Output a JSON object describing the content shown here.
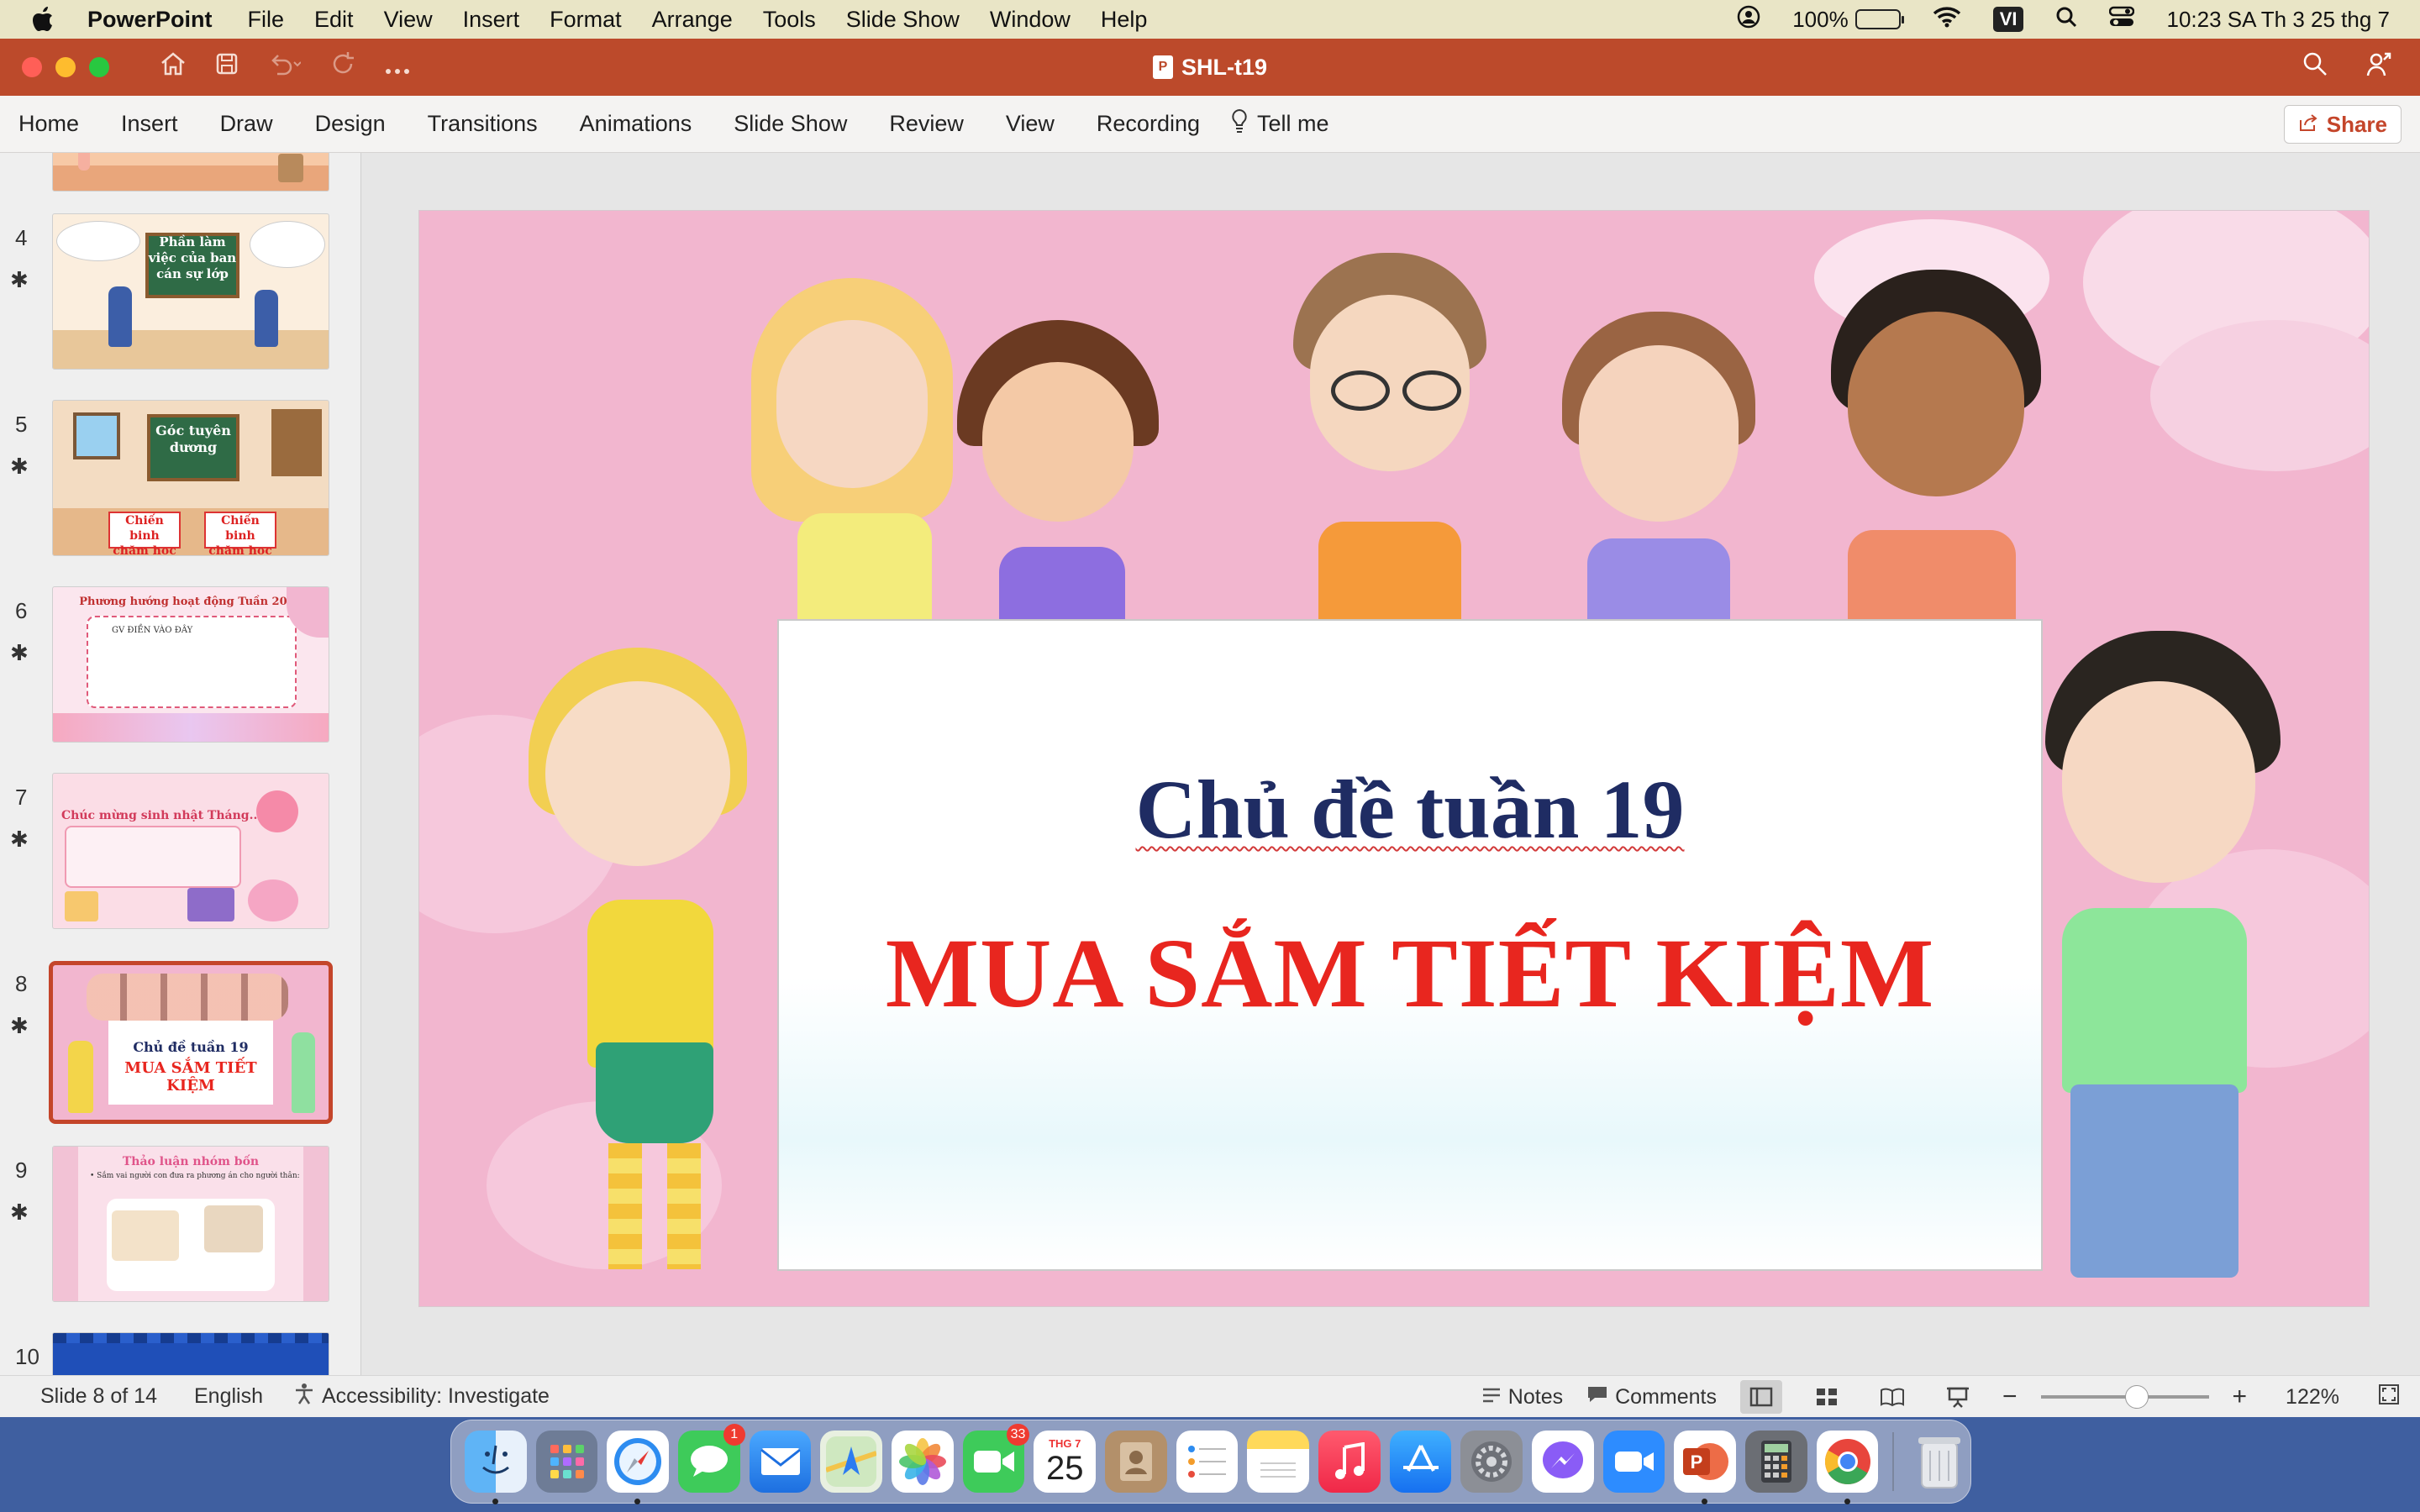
{
  "menubar": {
    "app_name": "PowerPoint",
    "menus": [
      "File",
      "Edit",
      "View",
      "Insert",
      "Format",
      "Arrange",
      "Tools",
      "Slide Show",
      "Window",
      "Help"
    ],
    "battery": "100%",
    "input_source": "VI",
    "clock": "10:23 SA Th 3 25 thg 7"
  },
  "titlebar": {
    "doc_title": "SHL-t19",
    "colors": {
      "bar": "#bc4a2b"
    }
  },
  "ribbon": {
    "tabs": [
      "Home",
      "Insert",
      "Draw",
      "Design",
      "Transitions",
      "Animations",
      "Slide Show",
      "Review",
      "View",
      "Recording"
    ],
    "tell_me": "Tell me",
    "share": "Share"
  },
  "thumbnails": [
    {
      "num": "4",
      "lines": [
        "Phần làm",
        "việc của ban",
        "cán sự lớp"
      ]
    },
    {
      "num": "5",
      "lines": [
        "Góc tuyên",
        "dương",
        "Chiến binh",
        "chăm học"
      ]
    },
    {
      "num": "6",
      "lines": [
        "Phương hướng hoạt động Tuần 20 ...",
        "GV ĐIỀN VÀO ĐÂY"
      ]
    },
    {
      "num": "7",
      "lines": [
        "Chúc mừng sinh nhật Tháng..."
      ]
    },
    {
      "num": "8",
      "lines": [
        "Chủ đề tuần 19",
        "MUA SẮM TIẾT KIỆM"
      ],
      "selected": true
    },
    {
      "num": "9",
      "lines": [
        "Thảo luận nhóm bốn",
        "Sắm vai người con đưa ra phương án cho người thân:"
      ]
    },
    {
      "num": "10",
      "lines": []
    }
  ],
  "slide": {
    "title": "Chủ đề tuần 19",
    "subtitle": "MUA SẮM TIẾT KIỆM"
  },
  "statusbar": {
    "slide_position": "Slide 8 of 14",
    "language": "English",
    "accessibility": "Accessibility: Investigate",
    "notes": "Notes",
    "comments": "Comments",
    "zoom": "122%"
  },
  "dock": {
    "messages_badge": "1",
    "facetime_badge": "33",
    "calendar_month": "THG 7",
    "calendar_day": "25"
  }
}
